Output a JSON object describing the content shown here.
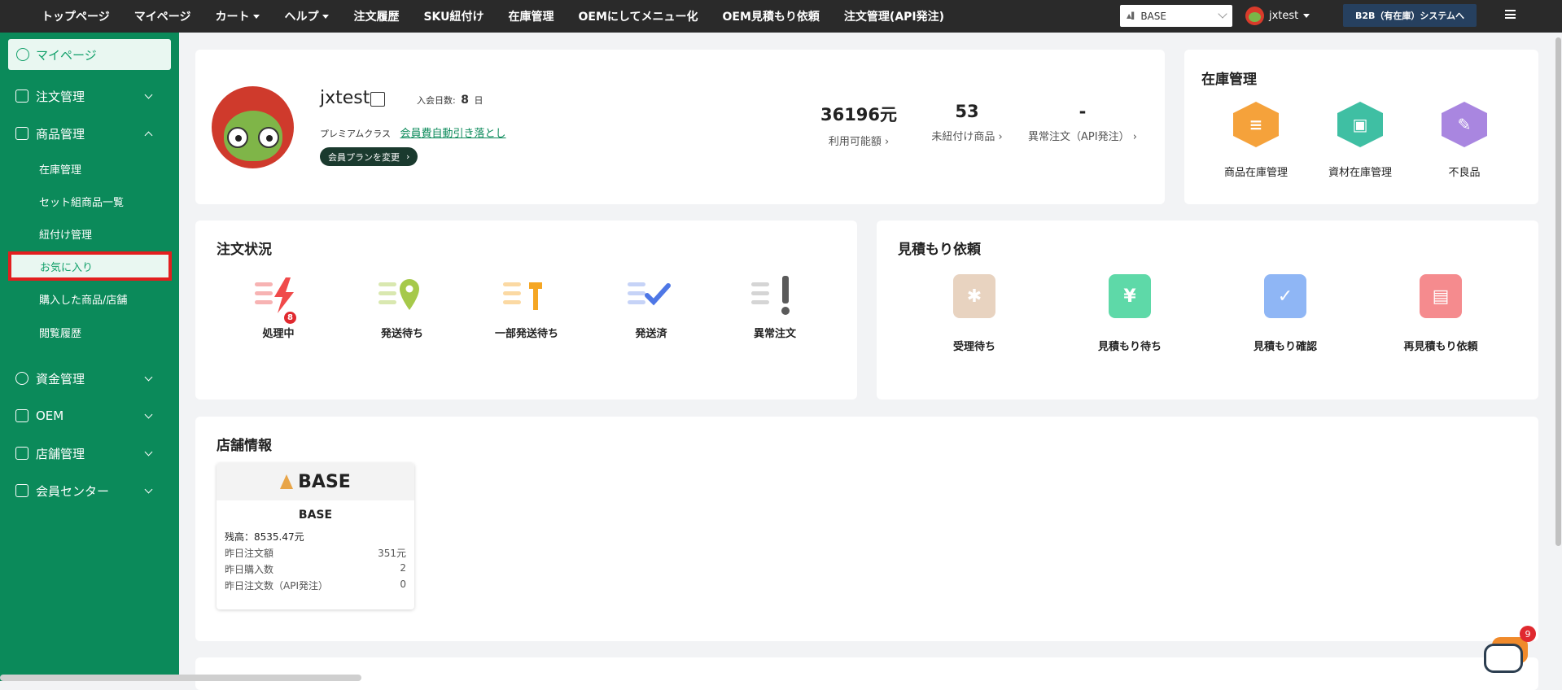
{
  "topnav": {
    "items": [
      "トップページ",
      "マイページ",
      "カート",
      "ヘルプ",
      "注文履歴",
      "SKU紐付け",
      "在庫管理",
      "OEMにしてメニュー化",
      "OEM見積もり依頼",
      "注文管理(API発注)"
    ],
    "shop_select": "BASE",
    "username": "jxtest",
    "system_button": "B2B（有在庫）システムへ"
  },
  "sidebar": {
    "mypage": "マイページ",
    "order_mgmt": "注文管理",
    "product_mgmt": "商品管理",
    "product_sub": [
      "在庫管理",
      "セット組商品一覧",
      "紐付け管理",
      "お気に入り",
      "購入した商品/店舗",
      "閲覧履歴"
    ],
    "fund_mgmt": "資金管理",
    "oem": "OEM",
    "store_mgmt": "店舗管理",
    "member_center": "会員センター"
  },
  "profile": {
    "username": "jxtest",
    "join_label": "入会日数:",
    "join_days": "8",
    "join_unit": "日",
    "class_label": "プレミアムクラス",
    "autopay_link": "会員費自動引き落とし",
    "plan_button": "会員プランを変更",
    "stats": [
      {
        "value": "36196元",
        "label": "利用可能額"
      },
      {
        "value": "53",
        "label": "未紐付け商品"
      },
      {
        "value": "-",
        "label": "異常注文（API発注）"
      }
    ]
  },
  "inventory": {
    "title": "在庫管理",
    "items": [
      {
        "label": "商品在庫管理",
        "color": "#f5a23b"
      },
      {
        "label": "資材在庫管理",
        "color": "#3fbfa3"
      },
      {
        "label": "不良品",
        "color": "#a986e0"
      }
    ]
  },
  "order_status": {
    "title": "注文状況",
    "processing_badge": "8",
    "items": [
      "処理中",
      "発送待ち",
      "一部発送待ち",
      "発送済",
      "異常注文"
    ]
  },
  "quote": {
    "title": "見積もり依頼",
    "items": [
      {
        "label": "受理待ち",
        "color": "#e8d3c0"
      },
      {
        "label": "見積もり待ち",
        "color": "#5ed9a8"
      },
      {
        "label": "見積もり確認",
        "color": "#8fb6f5"
      },
      {
        "label": "再見積もり依頼",
        "color": "#f58b8e"
      }
    ]
  },
  "store_info": {
    "title": "店舗情報",
    "logo_text": "BASE",
    "store_name": "BASE",
    "balance": "残高：8535.47元",
    "rows": [
      {
        "label": "昨日注文額",
        "value": "351元"
      },
      {
        "label": "昨日購入数",
        "value": "2"
      },
      {
        "label": "昨日注文数（API発注）",
        "value": "0"
      }
    ]
  },
  "chat": {
    "badge": "9"
  }
}
